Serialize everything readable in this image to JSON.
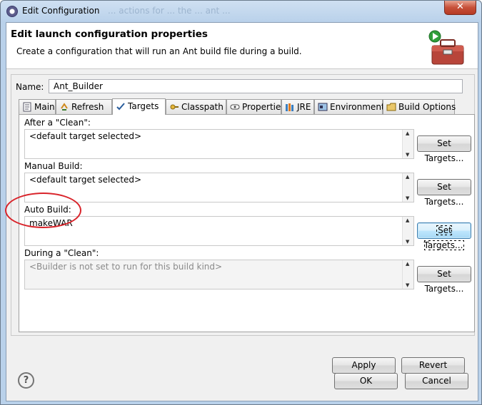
{
  "window": {
    "title": "Edit Configuration",
    "title_ghost": "... actions for ... the ... ant ...",
    "close_symbol": "✕"
  },
  "header": {
    "title": "Edit launch configuration properties",
    "description": "Create a configuration that will run an Ant build file during a build."
  },
  "form": {
    "name_label": "Name:",
    "name_value": "Ant_Builder"
  },
  "tabs": [
    {
      "label": "Main",
      "icon": "main-doc-icon",
      "active": false
    },
    {
      "label": "Refresh",
      "icon": "refresh-icon",
      "active": false
    },
    {
      "label": "Targets",
      "icon": "targets-icon",
      "active": true
    },
    {
      "label": "Classpath",
      "icon": "classpath-icon",
      "active": false
    },
    {
      "label": "Properties",
      "icon": "properties-icon",
      "active": false
    },
    {
      "label": "JRE",
      "icon": "jre-icon",
      "active": false
    },
    {
      "label": "Environment",
      "icon": "environment-icon",
      "active": false
    },
    {
      "label": "Build Options",
      "icon": "build-options-icon",
      "active": false
    }
  ],
  "targets": {
    "after_clean": {
      "label": "After a \"Clean\":",
      "value": "<default target selected>",
      "button": "Set Targets..."
    },
    "manual_build": {
      "label": "Manual Build:",
      "value": "<default target selected>",
      "button": "Set Targets..."
    },
    "auto_build": {
      "label": "Auto Build:",
      "value": "makeWAR",
      "button": "Set Targets..."
    },
    "during_clean": {
      "label": "During a \"Clean\":",
      "value": "<Builder is not set to run for this build kind>",
      "button": "Set Targets..."
    }
  },
  "buttons": {
    "apply": "Apply",
    "revert": "Revert",
    "ok": "OK",
    "cancel": "Cancel",
    "help": "?"
  },
  "annotation": {
    "color": "#d9232a"
  }
}
